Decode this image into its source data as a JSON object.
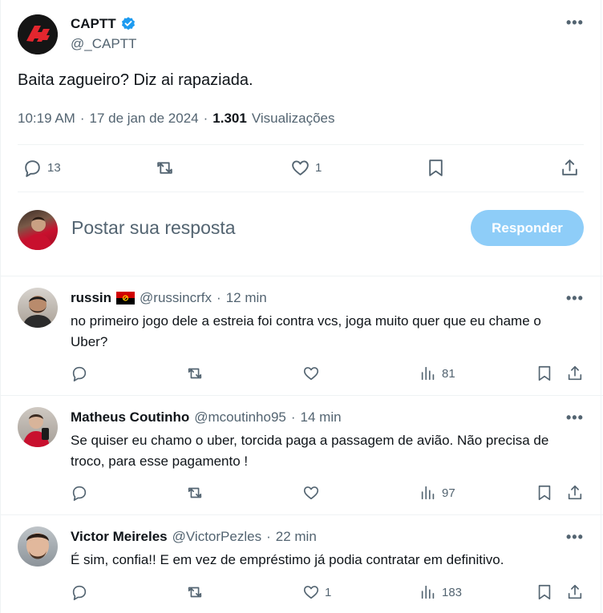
{
  "post": {
    "author_name": "CAPTT",
    "author_handle": "@_CAPTT",
    "text": "Baita zagueiro? Diz ai rapaziada.",
    "time": "10:19 AM",
    "date": "17 de jan de 2024",
    "views_count": "1.301",
    "views_label": "Visualizações",
    "reply_count": "13",
    "like_count": "1"
  },
  "composer": {
    "placeholder": "Postar sua resposta",
    "button_label": "Responder"
  },
  "replies": [
    {
      "name": "russin",
      "handle": "@russincrfx",
      "time": "12 min",
      "text": "no primeiro jogo dele a estreia foi contra vcs, joga muito quer que eu chame o Uber?",
      "likes": "",
      "views": "81"
    },
    {
      "name": "Matheus Coutinho",
      "handle": "@mcoutinho95",
      "time": "14 min",
      "text": "Se quiser eu chamo o uber, torcida  paga a passagem de avião.  Não precisa de troco, para esse pagamento !",
      "likes": "",
      "views": "97"
    },
    {
      "name": "Victor Meireles",
      "handle": "@VictorPezles",
      "time": "22 min",
      "text": "É sim, confia!! E em vez de empréstimo já podia contratar em definitivo.",
      "likes": "1",
      "views": "183"
    }
  ],
  "separator": "·",
  "more_glyph": "•••",
  "colors": {
    "accent": "#1d9bf0",
    "accent_disabled": "#8ecdf8",
    "text": "#0f1419",
    "muted": "#536471",
    "border": "#eff3f4",
    "flag_red": "#d00000"
  }
}
